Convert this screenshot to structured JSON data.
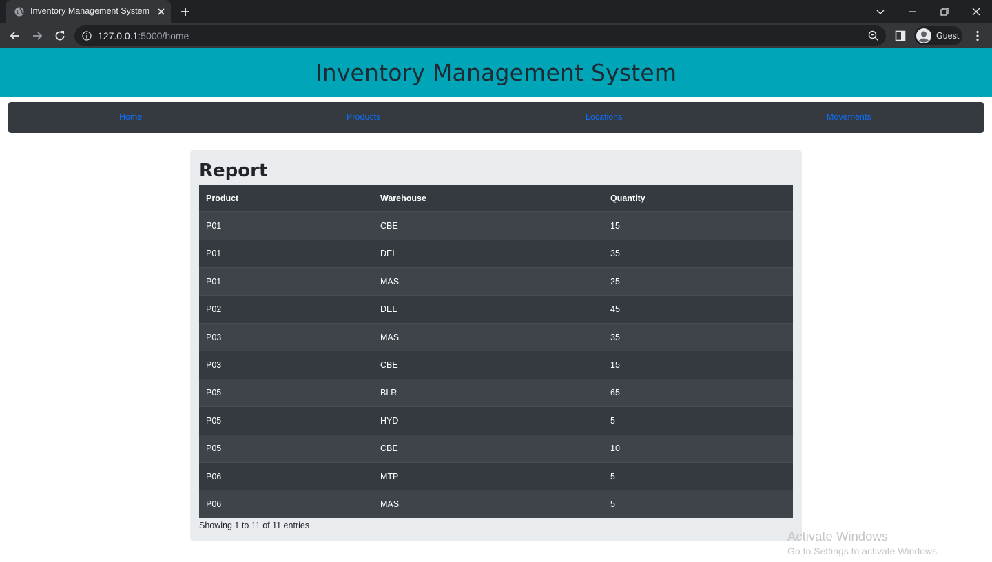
{
  "browser": {
    "tab_title": "Inventory Management System",
    "profile_label": "Guest",
    "url_host": "127.0.0.1",
    "url_path": ":5000/home",
    "icons": [
      "globe-icon",
      "close-icon",
      "plus-icon",
      "chevron-down-icon",
      "minimize-icon",
      "restore-icon",
      "close-icon",
      "back-icon",
      "forward-icon",
      "reload-icon",
      "info-icon",
      "zoom-icon",
      "side-panel-icon",
      "avatar-icon",
      "more-vert-icon"
    ]
  },
  "header": {
    "title": "Inventory Management System"
  },
  "nav": {
    "home": "Home",
    "products": "Products",
    "locations": "Locations",
    "movements": "Movements"
  },
  "report": {
    "title": "Report",
    "columns": [
      "Product",
      "Warehouse",
      "Quantity"
    ],
    "rows": [
      [
        "P01",
        "CBE",
        "15"
      ],
      [
        "P01",
        "DEL",
        "35"
      ],
      [
        "P01",
        "MAS",
        "25"
      ],
      [
        "P02",
        "DEL",
        "45"
      ],
      [
        "P03",
        "MAS",
        "35"
      ],
      [
        "P03",
        "CBE",
        "15"
      ],
      [
        "P05",
        "BLR",
        "65"
      ],
      [
        "P05",
        "HYD",
        "5"
      ],
      [
        "P05",
        "CBE",
        "10"
      ],
      [
        "P06",
        "MTP",
        "5"
      ],
      [
        "P06",
        "MAS",
        "5"
      ]
    ],
    "info": "Showing 1 to 11 of 11 entries"
  },
  "watermark": {
    "line1": "Activate Windows",
    "line2": "Go to Settings to activate Windows."
  },
  "colors": {
    "header_bg": "#00a5b8",
    "navbar_bg": "#343a40",
    "link": "#0d6efd",
    "card_bg": "#e9ecef",
    "table_dark": "#343a40",
    "table_stripe": "#3e444a"
  }
}
